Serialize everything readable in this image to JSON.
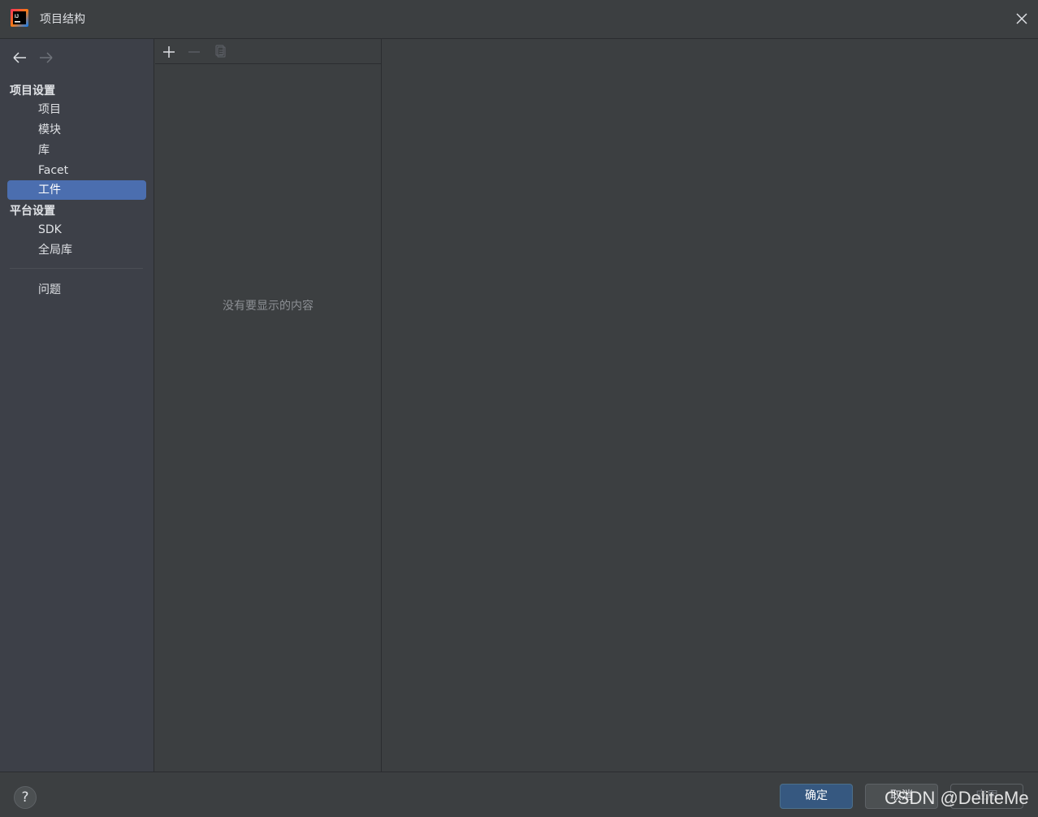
{
  "window": {
    "title": "项目结构",
    "icon": "intellij-app-icon",
    "close_icon": "close-icon"
  },
  "sidebar": {
    "back_icon": "arrow-left-icon",
    "forward_icon": "arrow-right-icon",
    "project_settings": {
      "header": "项目设置",
      "items": [
        {
          "label": "项目",
          "selected": false
        },
        {
          "label": "模块",
          "selected": false
        },
        {
          "label": "库",
          "selected": false
        },
        {
          "label": "Facet",
          "selected": false
        },
        {
          "label": "工件",
          "selected": true
        }
      ]
    },
    "platform_settings": {
      "header": "平台设置",
      "items": [
        {
          "label": "SDK",
          "selected": false
        },
        {
          "label": "全局库",
          "selected": false
        }
      ]
    },
    "problems": {
      "label": "问题"
    }
  },
  "middle": {
    "toolbar": {
      "add_icon": "plus-icon",
      "remove_icon": "minus-icon",
      "copy_icon": "copy-icon"
    },
    "empty_text": "没有要显示的内容"
  },
  "footer": {
    "help_label": "?",
    "ok_label": "确定",
    "cancel_label": "取消",
    "apply_label": "应用"
  },
  "watermark": "CSDN @DeliteMe",
  "colors": {
    "accent": "#4b6eaf",
    "ok_button": "#365880",
    "background": "#3c3f41",
    "sidebar": "#3d4048"
  }
}
